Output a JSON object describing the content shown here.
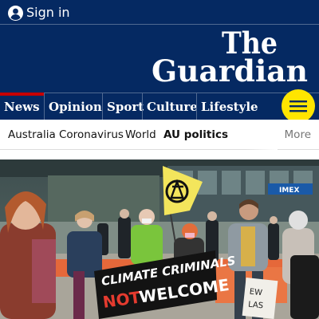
{
  "header": {
    "signin_label": "Sign in",
    "signin_icon": "user-circle-icon",
    "logo_line1": "The",
    "logo_line2": "Guardian",
    "background_color": "#052962"
  },
  "pillars": [
    {
      "label": "News",
      "accent": "#c70000",
      "active": true
    },
    {
      "label": "Opinion",
      "accent": "#e05e00"
    },
    {
      "label": "Sport",
      "accent": "#0084c6"
    },
    {
      "label": "Culture",
      "accent": "#a1845c"
    },
    {
      "label": "Lifestyle",
      "accent": "#bb3b80"
    }
  ],
  "menu_button": {
    "icon": "hamburger-menu-icon",
    "color": "#ffe500"
  },
  "subnav": {
    "items": [
      {
        "label": "Australia"
      },
      {
        "label": "Coronavirus"
      },
      {
        "label": "World"
      },
      {
        "label": "AU politics",
        "active": true
      }
    ],
    "more_label": "More"
  },
  "hero": {
    "banner_line1": "CLIMATE CRIMINALS",
    "banner_line2_red": "NOT",
    "banner_line2_white": "WELCOME",
    "sign_text": "…EW\nLAS",
    "building_sign": "IMEX"
  }
}
